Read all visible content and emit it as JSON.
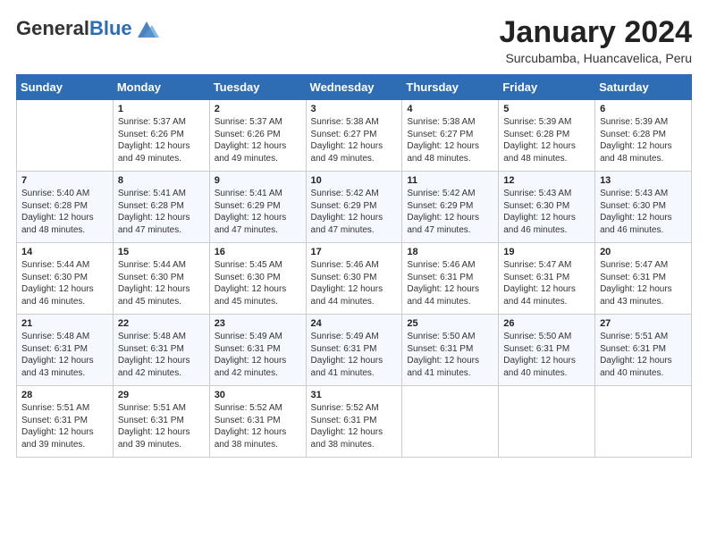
{
  "header": {
    "logo_general": "General",
    "logo_blue": "Blue",
    "month_title": "January 2024",
    "subtitle": "Surcubamba, Huancavelica, Peru"
  },
  "weekdays": [
    "Sunday",
    "Monday",
    "Tuesday",
    "Wednesday",
    "Thursday",
    "Friday",
    "Saturday"
  ],
  "weeks": [
    [
      {
        "day": "",
        "lines": []
      },
      {
        "day": "1",
        "lines": [
          "Sunrise: 5:37 AM",
          "Sunset: 6:26 PM",
          "Daylight: 12 hours",
          "and 49 minutes."
        ]
      },
      {
        "day": "2",
        "lines": [
          "Sunrise: 5:37 AM",
          "Sunset: 6:26 PM",
          "Daylight: 12 hours",
          "and 49 minutes."
        ]
      },
      {
        "day": "3",
        "lines": [
          "Sunrise: 5:38 AM",
          "Sunset: 6:27 PM",
          "Daylight: 12 hours",
          "and 49 minutes."
        ]
      },
      {
        "day": "4",
        "lines": [
          "Sunrise: 5:38 AM",
          "Sunset: 6:27 PM",
          "Daylight: 12 hours",
          "and 48 minutes."
        ]
      },
      {
        "day": "5",
        "lines": [
          "Sunrise: 5:39 AM",
          "Sunset: 6:28 PM",
          "Daylight: 12 hours",
          "and 48 minutes."
        ]
      },
      {
        "day": "6",
        "lines": [
          "Sunrise: 5:39 AM",
          "Sunset: 6:28 PM",
          "Daylight: 12 hours",
          "and 48 minutes."
        ]
      }
    ],
    [
      {
        "day": "7",
        "lines": [
          "Sunrise: 5:40 AM",
          "Sunset: 6:28 PM",
          "Daylight: 12 hours",
          "and 48 minutes."
        ]
      },
      {
        "day": "8",
        "lines": [
          "Sunrise: 5:41 AM",
          "Sunset: 6:28 PM",
          "Daylight: 12 hours",
          "and 47 minutes."
        ]
      },
      {
        "day": "9",
        "lines": [
          "Sunrise: 5:41 AM",
          "Sunset: 6:29 PM",
          "Daylight: 12 hours",
          "and 47 minutes."
        ]
      },
      {
        "day": "10",
        "lines": [
          "Sunrise: 5:42 AM",
          "Sunset: 6:29 PM",
          "Daylight: 12 hours",
          "and 47 minutes."
        ]
      },
      {
        "day": "11",
        "lines": [
          "Sunrise: 5:42 AM",
          "Sunset: 6:29 PM",
          "Daylight: 12 hours",
          "and 47 minutes."
        ]
      },
      {
        "day": "12",
        "lines": [
          "Sunrise: 5:43 AM",
          "Sunset: 6:30 PM",
          "Daylight: 12 hours",
          "and 46 minutes."
        ]
      },
      {
        "day": "13",
        "lines": [
          "Sunrise: 5:43 AM",
          "Sunset: 6:30 PM",
          "Daylight: 12 hours",
          "and 46 minutes."
        ]
      }
    ],
    [
      {
        "day": "14",
        "lines": [
          "Sunrise: 5:44 AM",
          "Sunset: 6:30 PM",
          "Daylight: 12 hours",
          "and 46 minutes."
        ]
      },
      {
        "day": "15",
        "lines": [
          "Sunrise: 5:44 AM",
          "Sunset: 6:30 PM",
          "Daylight: 12 hours",
          "and 45 minutes."
        ]
      },
      {
        "day": "16",
        "lines": [
          "Sunrise: 5:45 AM",
          "Sunset: 6:30 PM",
          "Daylight: 12 hours",
          "and 45 minutes."
        ]
      },
      {
        "day": "17",
        "lines": [
          "Sunrise: 5:46 AM",
          "Sunset: 6:30 PM",
          "Daylight: 12 hours",
          "and 44 minutes."
        ]
      },
      {
        "day": "18",
        "lines": [
          "Sunrise: 5:46 AM",
          "Sunset: 6:31 PM",
          "Daylight: 12 hours",
          "and 44 minutes."
        ]
      },
      {
        "day": "19",
        "lines": [
          "Sunrise: 5:47 AM",
          "Sunset: 6:31 PM",
          "Daylight: 12 hours",
          "and 44 minutes."
        ]
      },
      {
        "day": "20",
        "lines": [
          "Sunrise: 5:47 AM",
          "Sunset: 6:31 PM",
          "Daylight: 12 hours",
          "and 43 minutes."
        ]
      }
    ],
    [
      {
        "day": "21",
        "lines": [
          "Sunrise: 5:48 AM",
          "Sunset: 6:31 PM",
          "Daylight: 12 hours",
          "and 43 minutes."
        ]
      },
      {
        "day": "22",
        "lines": [
          "Sunrise: 5:48 AM",
          "Sunset: 6:31 PM",
          "Daylight: 12 hours",
          "and 42 minutes."
        ]
      },
      {
        "day": "23",
        "lines": [
          "Sunrise: 5:49 AM",
          "Sunset: 6:31 PM",
          "Daylight: 12 hours",
          "and 42 minutes."
        ]
      },
      {
        "day": "24",
        "lines": [
          "Sunrise: 5:49 AM",
          "Sunset: 6:31 PM",
          "Daylight: 12 hours",
          "and 41 minutes."
        ]
      },
      {
        "day": "25",
        "lines": [
          "Sunrise: 5:50 AM",
          "Sunset: 6:31 PM",
          "Daylight: 12 hours",
          "and 41 minutes."
        ]
      },
      {
        "day": "26",
        "lines": [
          "Sunrise: 5:50 AM",
          "Sunset: 6:31 PM",
          "Daylight: 12 hours",
          "and 40 minutes."
        ]
      },
      {
        "day": "27",
        "lines": [
          "Sunrise: 5:51 AM",
          "Sunset: 6:31 PM",
          "Daylight: 12 hours",
          "and 40 minutes."
        ]
      }
    ],
    [
      {
        "day": "28",
        "lines": [
          "Sunrise: 5:51 AM",
          "Sunset: 6:31 PM",
          "Daylight: 12 hours",
          "and 39 minutes."
        ]
      },
      {
        "day": "29",
        "lines": [
          "Sunrise: 5:51 AM",
          "Sunset: 6:31 PM",
          "Daylight: 12 hours",
          "and 39 minutes."
        ]
      },
      {
        "day": "30",
        "lines": [
          "Sunrise: 5:52 AM",
          "Sunset: 6:31 PM",
          "Daylight: 12 hours",
          "and 38 minutes."
        ]
      },
      {
        "day": "31",
        "lines": [
          "Sunrise: 5:52 AM",
          "Sunset: 6:31 PM",
          "Daylight: 12 hours",
          "and 38 minutes."
        ]
      },
      {
        "day": "",
        "lines": []
      },
      {
        "day": "",
        "lines": []
      },
      {
        "day": "",
        "lines": []
      }
    ]
  ]
}
